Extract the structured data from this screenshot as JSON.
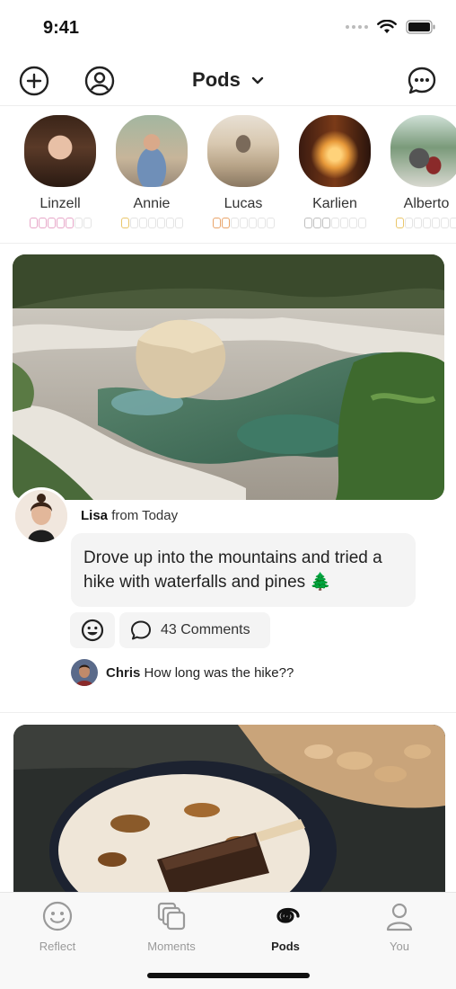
{
  "status": {
    "time": "9:41"
  },
  "header": {
    "title": "Pods"
  },
  "stories": [
    {
      "name": "Linzell",
      "dot_color": "#e7a6c8",
      "filled": 5,
      "total": 7
    },
    {
      "name": "Annie",
      "dot_color": "#e9c66a",
      "filled": 1,
      "total": 7
    },
    {
      "name": "Lucas",
      "dot_color": "#e9a46a",
      "filled": 2,
      "total": 7
    },
    {
      "name": "Karlien",
      "dot_color": "#bfbfbf",
      "filled": 3,
      "total": 7
    },
    {
      "name": "Alberto",
      "dot_color": "#e9c66a",
      "filled": 1,
      "total": 7
    }
  ],
  "post": {
    "author": "Lisa",
    "time_label": "from Today",
    "text": "Drove up into the mountains and tried a hike with waterfalls and pines 🌲",
    "comments_label": "43 Comments",
    "top_comment": {
      "author": "Chris",
      "text": "How long was the hike??"
    }
  },
  "tabs": [
    {
      "label": "Reflect",
      "icon": "smiley-icon",
      "active": false
    },
    {
      "label": "Moments",
      "icon": "stack-icon",
      "active": false
    },
    {
      "label": "Pods",
      "icon": "spiral-icon",
      "active": true
    },
    {
      "label": "You",
      "icon": "person-icon",
      "active": false
    }
  ]
}
